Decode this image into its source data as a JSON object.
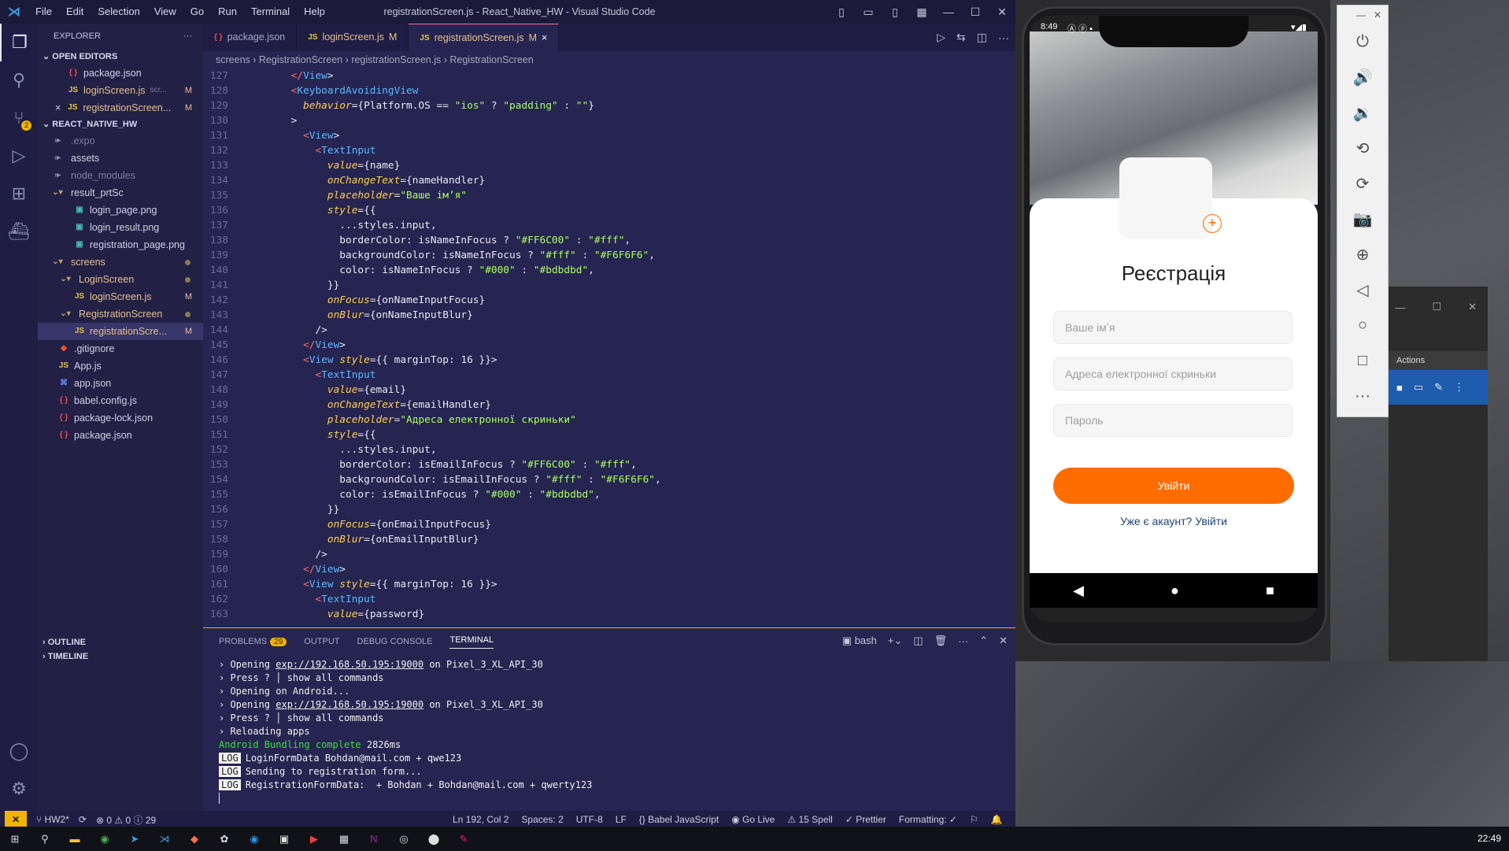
{
  "window": {
    "title": "registrationScreen.js - React_Native_HW - Visual Studio Code",
    "menu": [
      "File",
      "Edit",
      "Selection",
      "View",
      "Go",
      "Run",
      "Terminal",
      "Help"
    ]
  },
  "explorer": {
    "header": "EXPLORER",
    "open_editors": "OPEN EDITORS",
    "open_files": [
      {
        "name": "package.json",
        "kind": "json"
      },
      {
        "name": "loginScreen.js",
        "extra": "scr...",
        "status": "M",
        "kind": "js"
      },
      {
        "name": "registrationScreen...",
        "status": "M",
        "kind": "js",
        "close": "×"
      }
    ],
    "project": "REACT_NATIVE_HW",
    "tree": [
      {
        "name": ".expo",
        "type": "folder",
        "dim": true
      },
      {
        "name": "assets",
        "type": "folder"
      },
      {
        "name": "node_modules",
        "type": "folder",
        "dim": true
      },
      {
        "name": "result_prtSc",
        "type": "folder-open"
      },
      {
        "name": "login_page.png",
        "type": "img",
        "indent": 2
      },
      {
        "name": "login_result.png",
        "type": "img",
        "indent": 2
      },
      {
        "name": "registration_page.png",
        "type": "img",
        "indent": 2
      },
      {
        "name": "screens",
        "type": "folder-open",
        "mod": true
      },
      {
        "name": "LoginScreen",
        "type": "folder-open",
        "indent": 1,
        "mod": true
      },
      {
        "name": "loginScreen.js",
        "type": "js",
        "indent": 2,
        "status": "M"
      },
      {
        "name": "RegistrationScreen",
        "type": "folder-open",
        "indent": 1,
        "mod": true
      },
      {
        "name": "registrationScre...",
        "type": "js",
        "indent": 2,
        "status": "M",
        "sel": true
      },
      {
        "name": ".gitignore",
        "type": "git"
      },
      {
        "name": "App.js",
        "type": "js"
      },
      {
        "name": "app.json",
        "type": "app"
      },
      {
        "name": "babel.config.js",
        "type": "json"
      },
      {
        "name": "package-lock.json",
        "type": "json"
      },
      {
        "name": "package.json",
        "type": "json"
      }
    ],
    "outline": "OUTLINE",
    "timeline": "TIMELINE"
  },
  "tabs": [
    {
      "name": "package.json",
      "kind": "json"
    },
    {
      "name": "loginScreen.js",
      "status": "M",
      "kind": "js"
    },
    {
      "name": "registrationScreen.js",
      "status": "M",
      "kind": "js",
      "active": true,
      "close": "×"
    }
  ],
  "breadcrumb": [
    "screens",
    "RegistrationScreen",
    "registrationScreen.js",
    "RegistrationScreen"
  ],
  "code": [
    {
      "n": "127",
      "t": "        </View>"
    },
    {
      "n": "128",
      "t": "        <KeyboardAvoidingView"
    },
    {
      "n": "129",
      "t": "          behavior={Platform.OS == \"ios\" ? \"padding\" : \"\"}"
    },
    {
      "n": "130",
      "t": "        >"
    },
    {
      "n": "131",
      "t": "          <View>"
    },
    {
      "n": "132",
      "t": "            <TextInput"
    },
    {
      "n": "133",
      "t": "              value={name}"
    },
    {
      "n": "134",
      "t": "              onChangeText={nameHandler}"
    },
    {
      "n": "135",
      "t": "              placeholder=\"Ваше імʼя\""
    },
    {
      "n": "136",
      "t": "              style={{"
    },
    {
      "n": "137",
      "t": "                ...styles.input,"
    },
    {
      "n": "138",
      "t": "                borderColor: isNameInFocus ? \"#FF6C00\" : \"#fff\","
    },
    {
      "n": "139",
      "t": "                backgroundColor: isNameInFocus ? \"#fff\" : \"#F6F6F6\","
    },
    {
      "n": "140",
      "t": "                color: isNameInFocus ? \"#000\" : \"#bdbdbd\","
    },
    {
      "n": "141",
      "t": "              }}"
    },
    {
      "n": "142",
      "t": "              onFocus={onNameInputFocus}"
    },
    {
      "n": "143",
      "t": "              onBlur={onNameInputBlur}"
    },
    {
      "n": "144",
      "t": "            />"
    },
    {
      "n": "145",
      "t": "          </View>"
    },
    {
      "n": "146",
      "t": "          <View style={{ marginTop: 16 }}>"
    },
    {
      "n": "147",
      "t": "            <TextInput"
    },
    {
      "n": "148",
      "t": "              value={email}"
    },
    {
      "n": "149",
      "t": "              onChangeText={emailHandler}"
    },
    {
      "n": "150",
      "t": "              placeholder=\"Адреса електронної скриньки\""
    },
    {
      "n": "151",
      "t": "              style={{"
    },
    {
      "n": "152",
      "t": "                ...styles.input,"
    },
    {
      "n": "153",
      "t": "                borderColor: isEmailInFocus ? \"#FF6C00\" : \"#fff\","
    },
    {
      "n": "154",
      "t": "                backgroundColor: isEmailInFocus ? \"#fff\" : \"#F6F6F6\","
    },
    {
      "n": "155",
      "t": "                color: isEmailInFocus ? \"#000\" : \"#bdbdbd\","
    },
    {
      "n": "156",
      "t": "              }}"
    },
    {
      "n": "157",
      "t": "              onFocus={onEmailInputFocus}"
    },
    {
      "n": "158",
      "t": "              onBlur={onEmailInputBlur}"
    },
    {
      "n": "159",
      "t": "            />"
    },
    {
      "n": "160",
      "t": "          </View>"
    },
    {
      "n": "161",
      "t": "          <View style={{ marginTop: 16 }}>"
    },
    {
      "n": "162",
      "t": "            <TextInput"
    },
    {
      "n": "163",
      "t": "              value={password}"
    }
  ],
  "panel": {
    "tabs": [
      "PROBLEMS",
      "OUTPUT",
      "DEBUG CONSOLE",
      "TERMINAL"
    ],
    "problems_count": "29",
    "shell": "bash",
    "terminal": [
      {
        "type": "arrow",
        "text": "Opening ",
        "link": "exp://192.168.50.195:19000",
        "tail": " on Pixel_3_XL_API_30"
      },
      {
        "type": "arrow",
        "text": "Press ? │ show all commands"
      },
      {
        "type": "arrow",
        "text": "Opening on Android..."
      },
      {
        "type": "arrow",
        "text": "Opening ",
        "link": "exp://192.168.50.195:19000",
        "tail": " on Pixel_3_XL_API_30"
      },
      {
        "type": "arrow",
        "text": "Press ? │ show all commands"
      },
      {
        "type": "arrow",
        "text": "Reloading apps"
      },
      {
        "type": "bundle",
        "text": "Android Bundling complete",
        "tail": " 2826ms"
      },
      {
        "type": "log",
        "badge": "LOG",
        "text": "LoginFormData Bohdan@mail.com + qwe123"
      },
      {
        "type": "log",
        "badge": "LOG",
        "text": "Sending to registration form..."
      },
      {
        "type": "log",
        "badge": "LOG",
        "text": "RegistrationFormData:  + Bohdan + Bohdan@mail.com + qwerty123"
      }
    ]
  },
  "status": {
    "branch": "HW2*",
    "errors": "0",
    "warnings": "0",
    "info": "29",
    "position": "Ln 192, Col 2",
    "spaces": "Spaces: 2",
    "encoding": "UTF-8",
    "eol": "LF",
    "language": "Babel JavaScript",
    "golive": "Go Live",
    "spell": "15 Spell",
    "prettier": "Prettier",
    "formatting": "Formatting: ✓"
  },
  "phone": {
    "time": "8:49",
    "title": "Реєстрація",
    "placeholders": [
      "Ваше імʼя",
      "Адреса електронної скриньки",
      "Пароль"
    ],
    "button": "Увійти",
    "link": "Уже є акаунт? Увійти",
    "accent": "#FF6C00"
  },
  "extwin": {
    "actions": "Actions"
  },
  "taskbar": {
    "time": "22:49"
  }
}
